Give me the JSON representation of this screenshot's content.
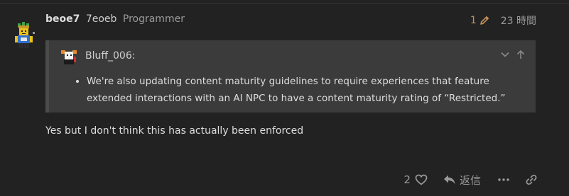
{
  "post": {
    "username": "beoe7",
    "full_name": "7eoeb",
    "user_title": "Programmer",
    "edit_count": "1",
    "time": "23 時間",
    "avatar_icon": "roblox-avatar-icon",
    "body": "Yes but I don't think this has actually been enforced"
  },
  "quote": {
    "username": "Bluff_006:",
    "avatar_icon": "quoted-user-avatar-icon",
    "items": [
      "We're also updating content maturity guidelines to require experiences that feature extended interactions with an AI NPC to have a content maturity rating of “Restricted.”"
    ]
  },
  "actions": {
    "like_count": "2",
    "reply_label": "返信"
  },
  "colors": {
    "background": "#222222",
    "quote_background": "#3b3b3b",
    "edit_accent": "#c5925a",
    "muted": "#9a9a9a"
  }
}
